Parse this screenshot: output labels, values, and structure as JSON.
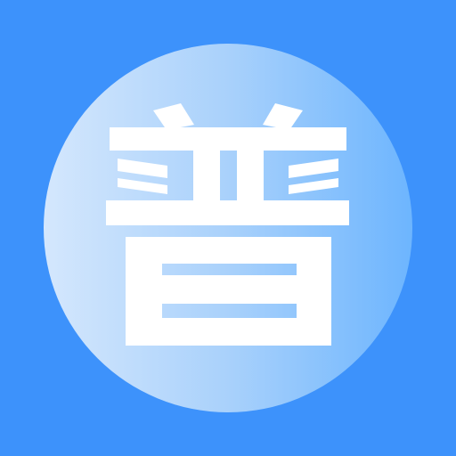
{
  "icon": {
    "glyph": "普",
    "glyph_icon": "pu-character-icon",
    "colors": {
      "background": "#3d92fb",
      "disc_left": "#d4e7fd",
      "disc_mid": "#a9d1fb",
      "disc_right": "#6db5fe",
      "glyph": "#ffffff"
    }
  }
}
